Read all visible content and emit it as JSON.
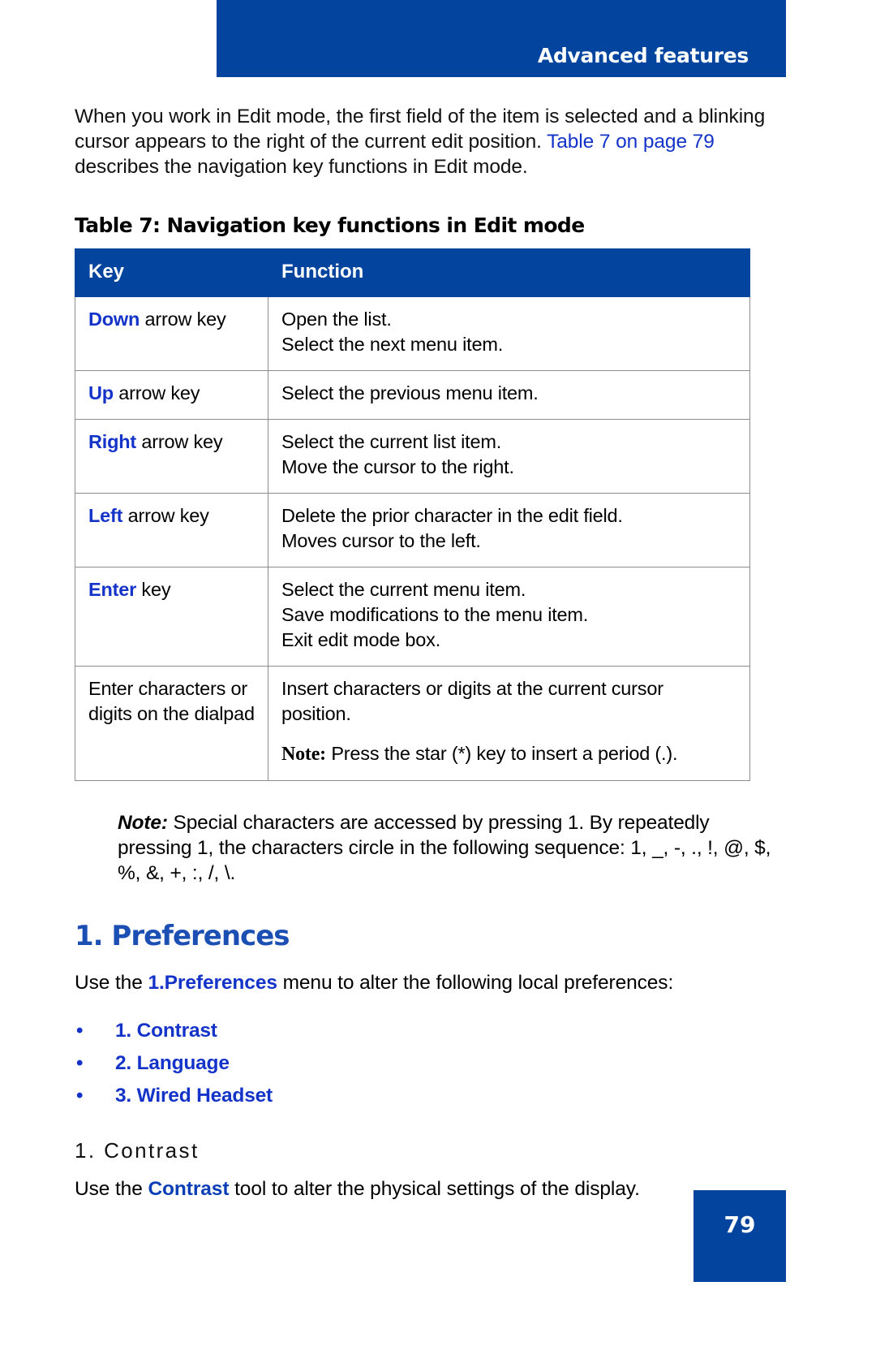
{
  "header": {
    "title": "Advanced features",
    "banner_color": "#03459e"
  },
  "intro": {
    "part1": "When you work in Edit mode, the first field of the item is selected and a blinking cursor appears to the right of the current edit position. ",
    "link": "Table 7 on page 79",
    "part2": " describes the navigation key functions in Edit mode."
  },
  "table": {
    "caption": "Table 7: Navigation key functions in Edit mode",
    "headers": {
      "key": "Key",
      "function": "Function"
    },
    "rows": [
      {
        "key_bold": "Down",
        "key_rest": " arrow key",
        "lines": [
          "Open the list.",
          "Select the next menu item."
        ]
      },
      {
        "key_bold": "Up",
        "key_rest": " arrow key",
        "lines": [
          "Select the previous menu item."
        ]
      },
      {
        "key_bold": "Right",
        "key_rest": " arrow key",
        "lines": [
          "Select the current list item.",
          "Move the cursor to the right."
        ]
      },
      {
        "key_bold": "Left",
        "key_rest": " arrow key",
        "lines": [
          "Delete the prior character in the edit field.",
          "Moves cursor to the left."
        ]
      },
      {
        "key_bold": "Enter",
        "key_rest": " key",
        "lines": [
          "Select the current menu item.",
          "Save modifications to the menu item.",
          "Exit edit mode box."
        ]
      },
      {
        "key_bold": "",
        "key_rest": "Enter characters or digits on the dialpad",
        "lines": [
          "Insert characters or digits at the current cursor position."
        ],
        "note_label": "Note:",
        "note_text": " Press the star (*) key to insert a period (.)."
      }
    ]
  },
  "note": {
    "label": "Note:",
    "text": " Special characters are accessed by pressing 1. By repeatedly pressing 1, the characters circle in the following sequence: 1, _, -, ., !, @, $, %, &, +, :, /, \\."
  },
  "section": {
    "heading": "1. Preferences",
    "lead_part1": "Use the ",
    "lead_link": "1.Preferences",
    "lead_part2": " menu to alter the following local preferences:",
    "bullet_glyph": "•",
    "items": [
      {
        "label": "1. Contrast"
      },
      {
        "label": "2. Language"
      },
      {
        "label": "3. Wired Headset"
      }
    ]
  },
  "subsection": {
    "heading": "1. Contrast",
    "body_part1": "Use the ",
    "body_link": "Contrast",
    "body_part2": " tool to alter the physical settings of the display."
  },
  "footer": {
    "page_number": "79"
  }
}
